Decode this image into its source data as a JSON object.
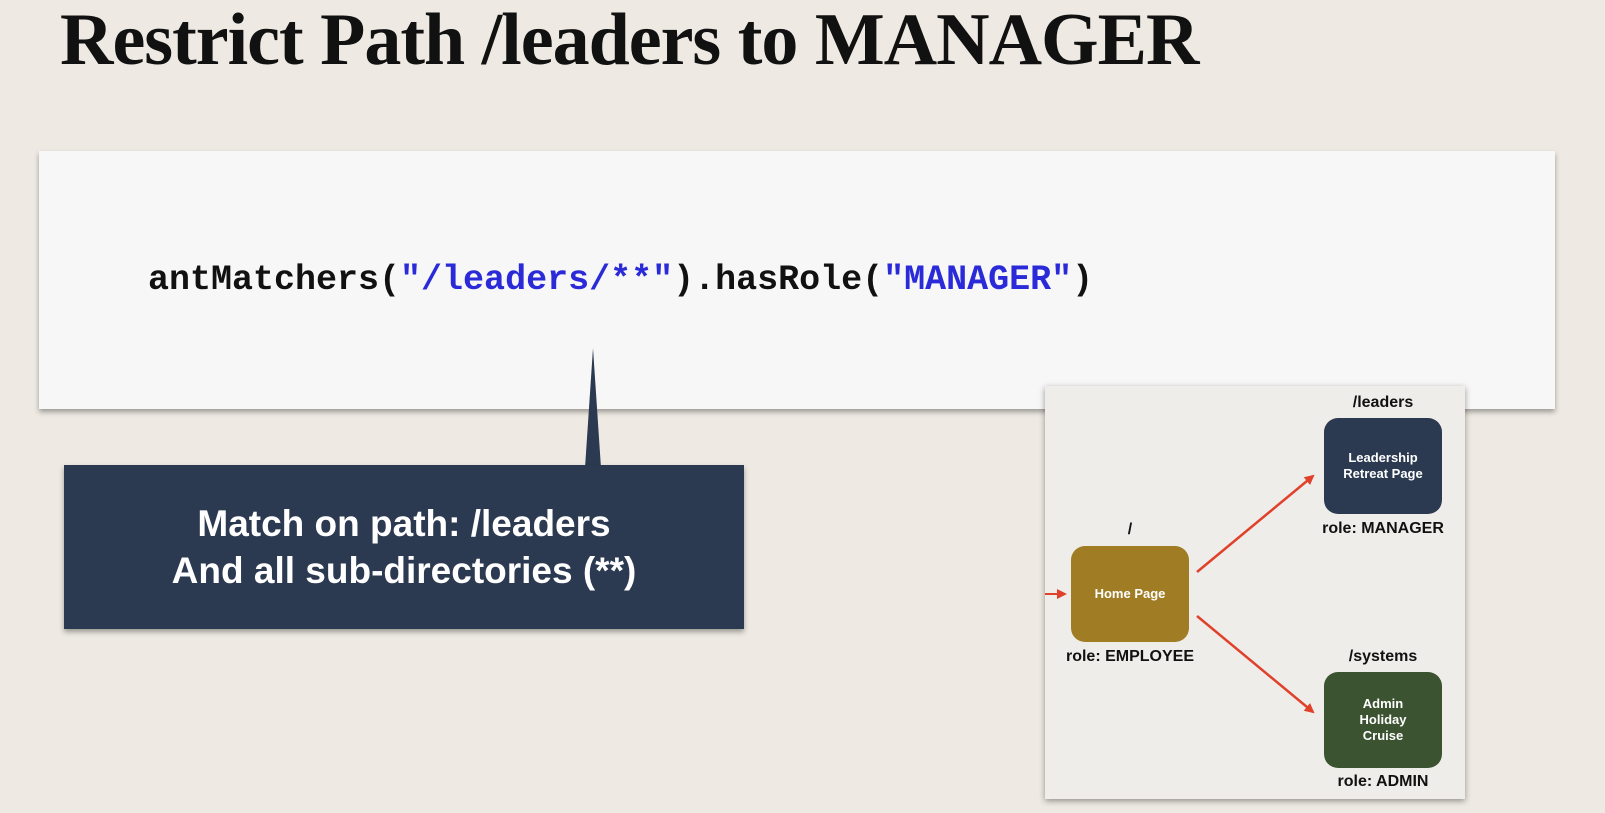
{
  "title": "Restrict Path /leaders to MANAGER",
  "code": {
    "prefix": "antMatchers(",
    "path_string": "\"/leaders/**\"",
    "middle": ").hasRole(",
    "role_string": "\"MANAGER\"",
    "suffix": ")"
  },
  "callout": {
    "line1": "Match on path: /leaders",
    "line2": "And all sub-directories (**)"
  },
  "diagram": {
    "home": {
      "path": "/",
      "label": "Home Page",
      "role": "role: EMPLOYEE"
    },
    "leaders": {
      "path": "/leaders",
      "label": "Leadership Retreat Page",
      "role": "role: MANAGER"
    },
    "systems": {
      "path": "/systems",
      "label": "Admin Holiday Cruise",
      "role": "role: ADMIN"
    }
  },
  "colors": {
    "background": "#eeeae3",
    "code_string": "#2a2ad8",
    "callout": "#2c3a51",
    "home_node": "#a07d24",
    "leaders_node": "#2c3a51",
    "systems_node": "#3c5331",
    "arrow": "#e0412b"
  }
}
